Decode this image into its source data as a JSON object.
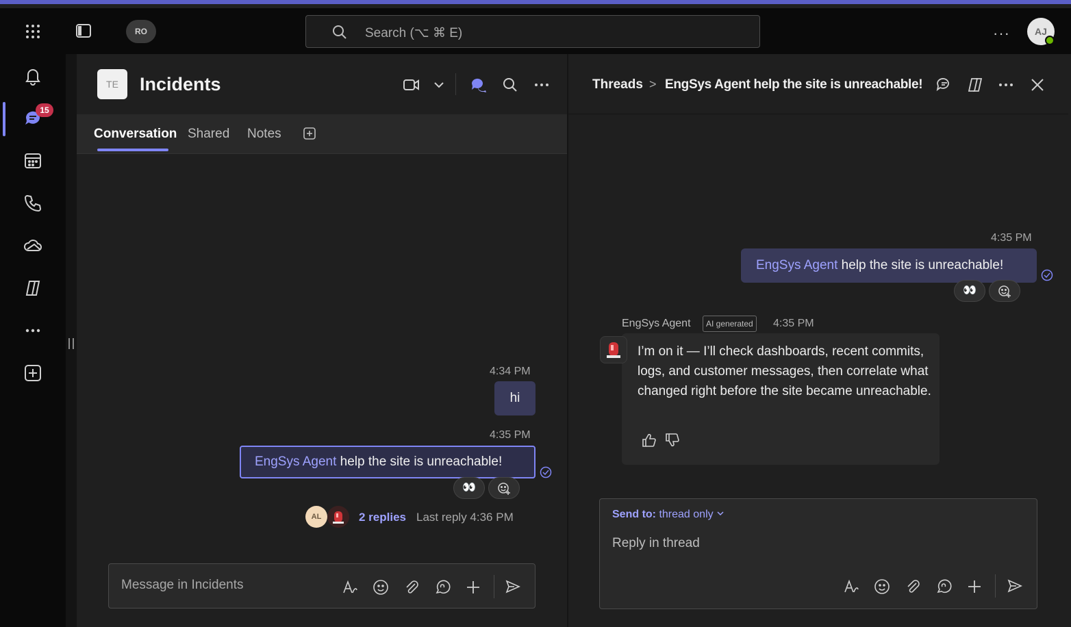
{
  "app": {
    "accent": "#5b5fc7",
    "user_initials_small": "RO",
    "user_initials": "AJ",
    "search_placeholder": "Search (⌥ ⌘ E)",
    "more": "···"
  },
  "rail": {
    "items": [
      "activity",
      "chat",
      "calendar",
      "calls",
      "onedrive",
      "copilot",
      "more",
      "apps"
    ],
    "chat_badge": "15"
  },
  "channel": {
    "team_initials": "TE",
    "title": "Incidents",
    "tabs": [
      {
        "label": "Conversation",
        "active": true
      },
      {
        "label": "Shared",
        "active": false
      },
      {
        "label": "Notes",
        "active": false
      }
    ],
    "messages": [
      {
        "time": "4:34 PM",
        "text": "hi"
      },
      {
        "time": "4:35 PM",
        "mention": "EngSys Agent",
        "text": " help the site is unreachable!"
      }
    ],
    "replies": {
      "avatar_initials": "AL",
      "link": "2 replies",
      "last": "Last reply 4:36 PM"
    },
    "composer_placeholder": "Message in Incidents"
  },
  "thread": {
    "breadcrumb_root": "Threads",
    "breadcrumb_sep": ">",
    "breadcrumb_title": "EngSys Agent help the site is unreachable!",
    "root_time": "4:35 PM",
    "root_mention": "EngSys Agent",
    "root_text": " help the site is unreachable!",
    "bot": {
      "name": "EngSys Agent",
      "tag": "AI generated",
      "time": "4:35 PM",
      "text": "I’m on it — I’ll check dashboards, recent commits, logs, and customer messages, then correlate what changed right before the site became unreachable."
    },
    "composer": {
      "send_to_label": "Send to:",
      "send_to_value": "thread only",
      "placeholder": "Reply in thread"
    }
  },
  "reactions": {
    "eyes": "👀"
  }
}
